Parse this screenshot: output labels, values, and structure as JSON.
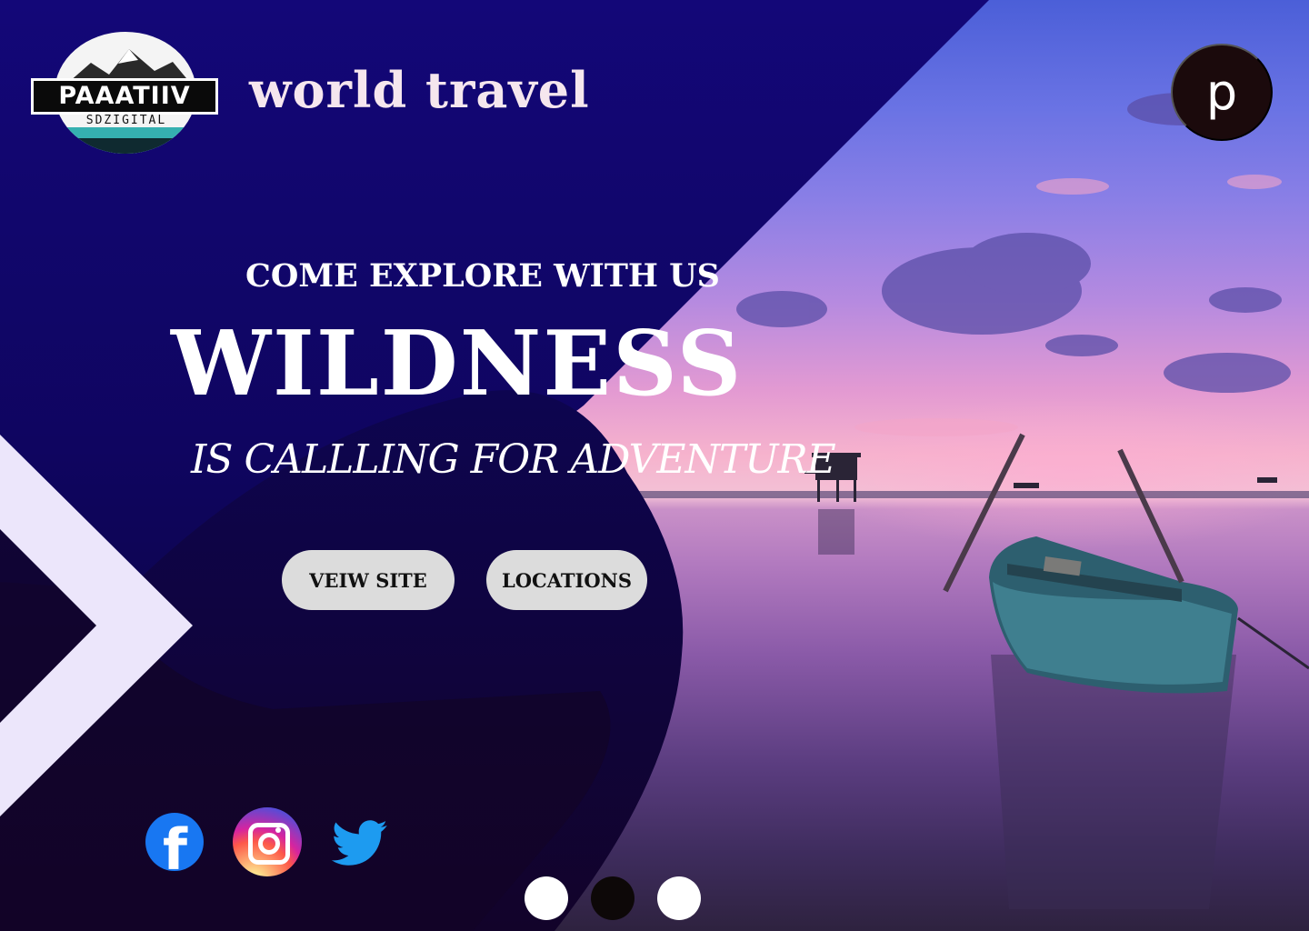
{
  "header": {
    "logo": {
      "wordmark": "PAAATIIV",
      "sub": "SDZIGITAL"
    },
    "brand_title": "world travel",
    "profile_initial": "p"
  },
  "hero": {
    "eyebrow": "COME EXPLORE WITH US",
    "headline": "WILDNESS",
    "tagline": "IS CALLLING FOR ADVENTURE",
    "buttons": {
      "view_site": "VEIW SITE",
      "locations": "LOCATIONS"
    }
  },
  "social": [
    {
      "name": "facebook",
      "icon": "facebook-icon"
    },
    {
      "name": "instagram",
      "icon": "instagram-icon"
    },
    {
      "name": "twitter",
      "icon": "twitter-icon"
    }
  ],
  "pagination": {
    "count": 3,
    "active_index": 2
  },
  "colors": {
    "navy": "#120677",
    "deep_navy": "#0e0640",
    "accent_light": "#ece6fb",
    "button_bg": "#dcdcdc"
  }
}
